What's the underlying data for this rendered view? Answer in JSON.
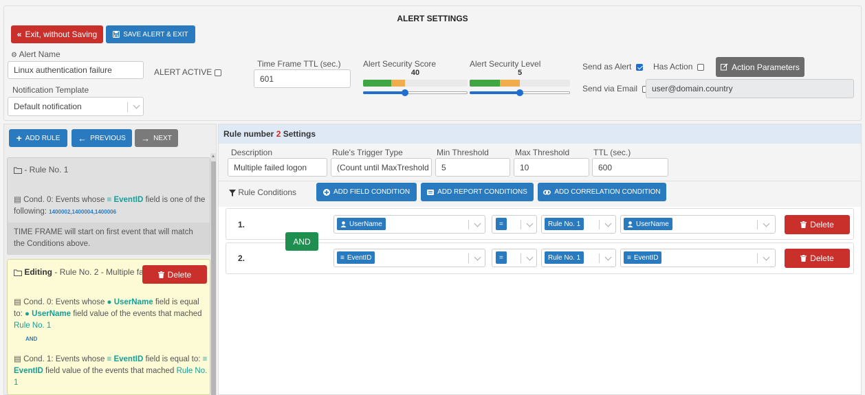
{
  "header": {
    "title": "ALERT SETTINGS",
    "exit_label": "Exit, without Saving",
    "save_label": "SAVE ALERT & EXIT"
  },
  "alert": {
    "name_label": "Alert Name",
    "name_value": "Linux authentication failure",
    "active_label": "ALERT ACTIVE",
    "notification_label": "Notification Template",
    "notification_value": "Default notification",
    "ttl_label": "Time Frame TTL (sec.)",
    "ttl_value": "601",
    "score_label": "Alert Security Score",
    "score_value": "40",
    "score_fraction": 0.4,
    "level_label": "Alert Security Level",
    "level_value": "5",
    "level_fraction": 0.5,
    "send_alert_label": "Send as Alert",
    "send_alert_checked": true,
    "has_action_label": "Has Action",
    "action_params_label": "Action Parameters",
    "send_email_label": "Send via Email",
    "email_value": "user@domain.country"
  },
  "sidebar": {
    "add_rule_label": "ADD RULE",
    "previous_label": "PREVIOUS",
    "next_label": "NEXT",
    "rule1": {
      "title": "- Rule No. 1",
      "cond_prefix": "Cond. 0: Events whose",
      "field": "EventID",
      "cond_mid": "field is one of the following:",
      "values": "1400002,1400004,1400006",
      "timeframe": "TIME FRAME will start on first event that will match the Conditions above."
    },
    "rule2": {
      "editing": "Editing",
      "title_rest": "- Rule No. 2 - Multiple failed logon",
      "delete_label": "Delete",
      "c0_prefix": "Cond. 0: Events whose",
      "c0_field": "UserName",
      "c0_mid": "field is equal to:",
      "c0_field2": "UserName",
      "c0_suffix": "field value of the events that mached",
      "c0_rule": "Rule No. 1",
      "and": "AND",
      "c1_prefix": "Cond. 1: Events whose",
      "c1_field": "EventID",
      "c1_mid": "field is equal to:",
      "c1_field2": "EventID",
      "c1_suffix": "field value of the events that mached",
      "c1_rule": "Rule No. 1"
    }
  },
  "rule_settings": {
    "title_prefix": "Rule number",
    "rule_number": "2",
    "title_suffix": "Settings",
    "desc_label": "Description",
    "desc_value": "Multiple failed logon",
    "trigger_label": "Rule's Trigger Type",
    "trigger_value": "(Count until MaxTreshold",
    "min_label": "Min Threshold",
    "min_value": "5",
    "max_label": "Max Threshold",
    "max_value": "10",
    "ttl_label": "TTL (sec.)",
    "ttl_value": "600",
    "conditions_label": "Rule Conditions",
    "add_field_label": "ADD FIELD CONDITION",
    "add_report_label": "ADD REPORT CONDITIONS",
    "add_corr_label": "ADD CORRELATION CONDITION",
    "and_label": "AND",
    "conditions": [
      {
        "num": "1.",
        "field": "UserName",
        "op": "=",
        "rule": "Rule No. 1",
        "target": "UserName",
        "delete": "Delete"
      },
      {
        "num": "2.",
        "field": "EventID",
        "op": "=",
        "rule": "Rule No. 1",
        "target": "EventID",
        "delete": "Delete"
      }
    ]
  },
  "colors": {
    "red": "#c9302c",
    "blue": "#2a7ac0",
    "gray": "#6c6c6c",
    "green": "#1e8f4e",
    "teal": "#14a098"
  }
}
